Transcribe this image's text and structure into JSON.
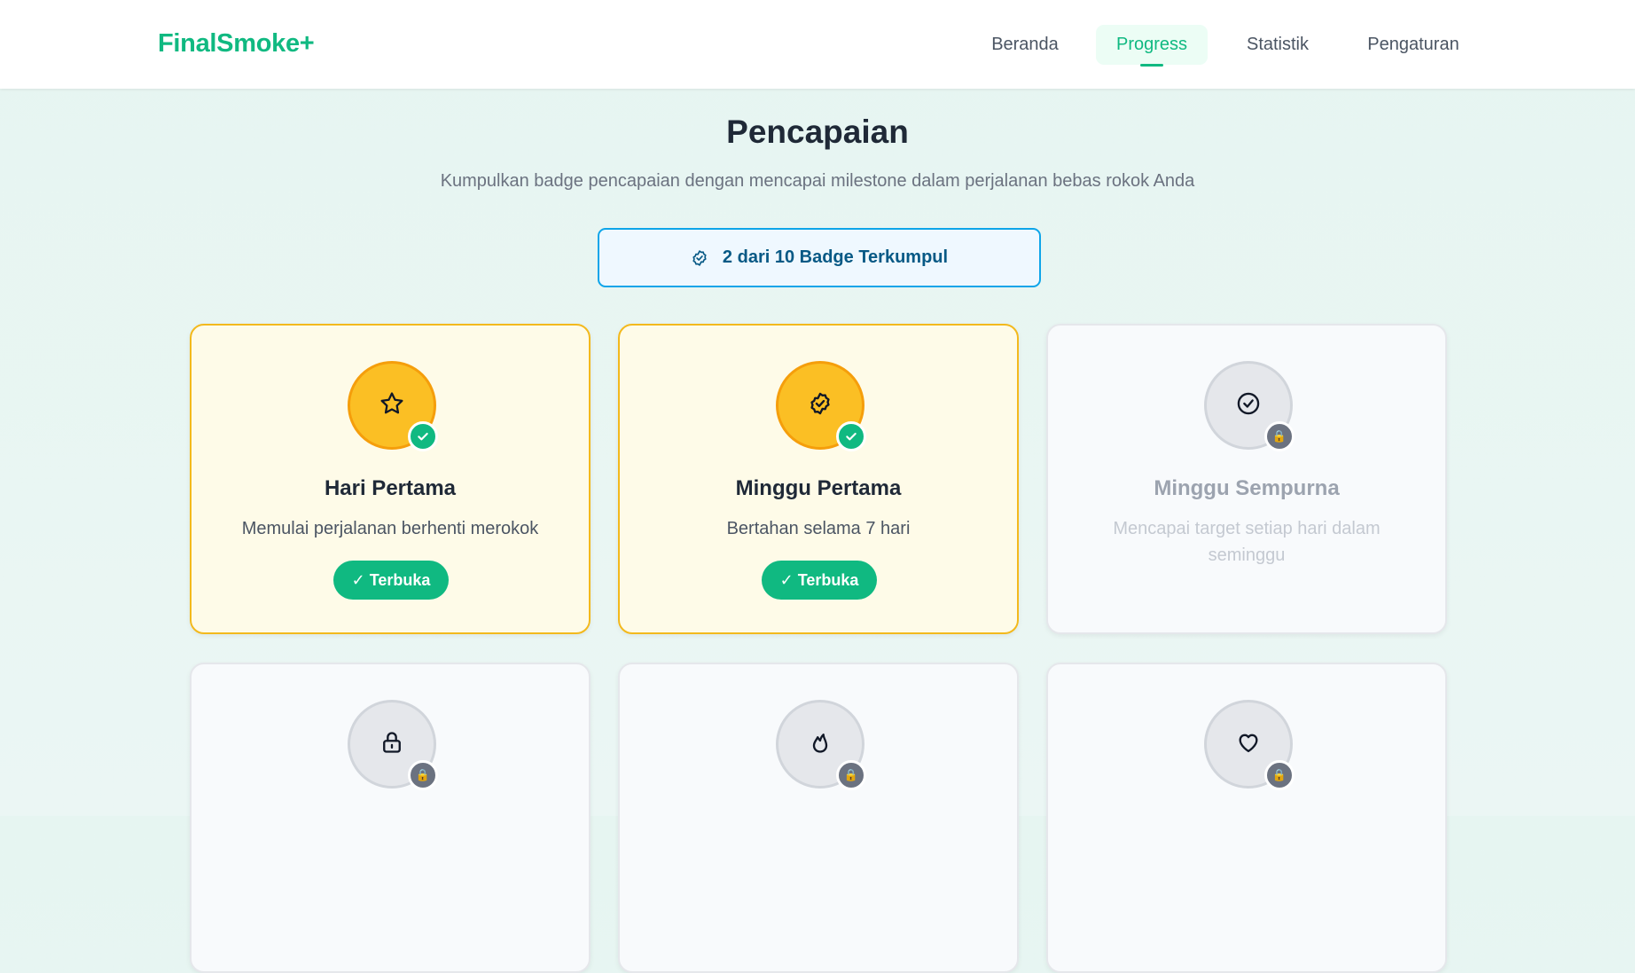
{
  "app": {
    "brand": "FinalSmoke+"
  },
  "nav": {
    "items": [
      {
        "label": "Beranda",
        "active": false
      },
      {
        "label": "Progress",
        "active": true
      },
      {
        "label": "Statistik",
        "active": false
      },
      {
        "label": "Pengaturan",
        "active": false
      }
    ]
  },
  "page": {
    "title": "Pencapaian",
    "subtitle": "Kumpulkan badge pencapaian dengan mencapai milestone dalam perjalanan bebas rokok Anda"
  },
  "summary": {
    "icon": "badge-check-icon",
    "text": "2 dari 10 Badge Terkumpul"
  },
  "colors": {
    "brand": "#10b981",
    "summary_border": "#0ea5e9",
    "unlocked_bg": "#fefbe8",
    "unlocked_border": "#f3b91d",
    "badge_gold": "#fbbf24",
    "lock_gray": "#6b7280"
  },
  "badges": [
    {
      "title": "Hari Pertama",
      "description": "Memulai perjalanan berhenti merokok",
      "icon": "star-icon",
      "unlocked": true,
      "status_label": "✓ Terbuka"
    },
    {
      "title": "Minggu Pertama",
      "description": "Bertahan selama 7 hari",
      "icon": "seal-check-icon",
      "unlocked": true,
      "status_label": "✓ Terbuka"
    },
    {
      "title": "Minggu Sempurna",
      "description": "Mencapai target setiap hari dalam seminggu",
      "icon": "circle-check-icon",
      "unlocked": false,
      "lock_symbol": "🔒"
    },
    {
      "title": "",
      "description": "",
      "icon": "lock-open-icon",
      "unlocked": false,
      "lock_symbol": "🔒"
    },
    {
      "title": "",
      "description": "",
      "icon": "flame-icon",
      "unlocked": false,
      "lock_symbol": "🔒"
    },
    {
      "title": "",
      "description": "",
      "icon": "heart-icon",
      "unlocked": false,
      "lock_symbol": "🔒"
    }
  ]
}
